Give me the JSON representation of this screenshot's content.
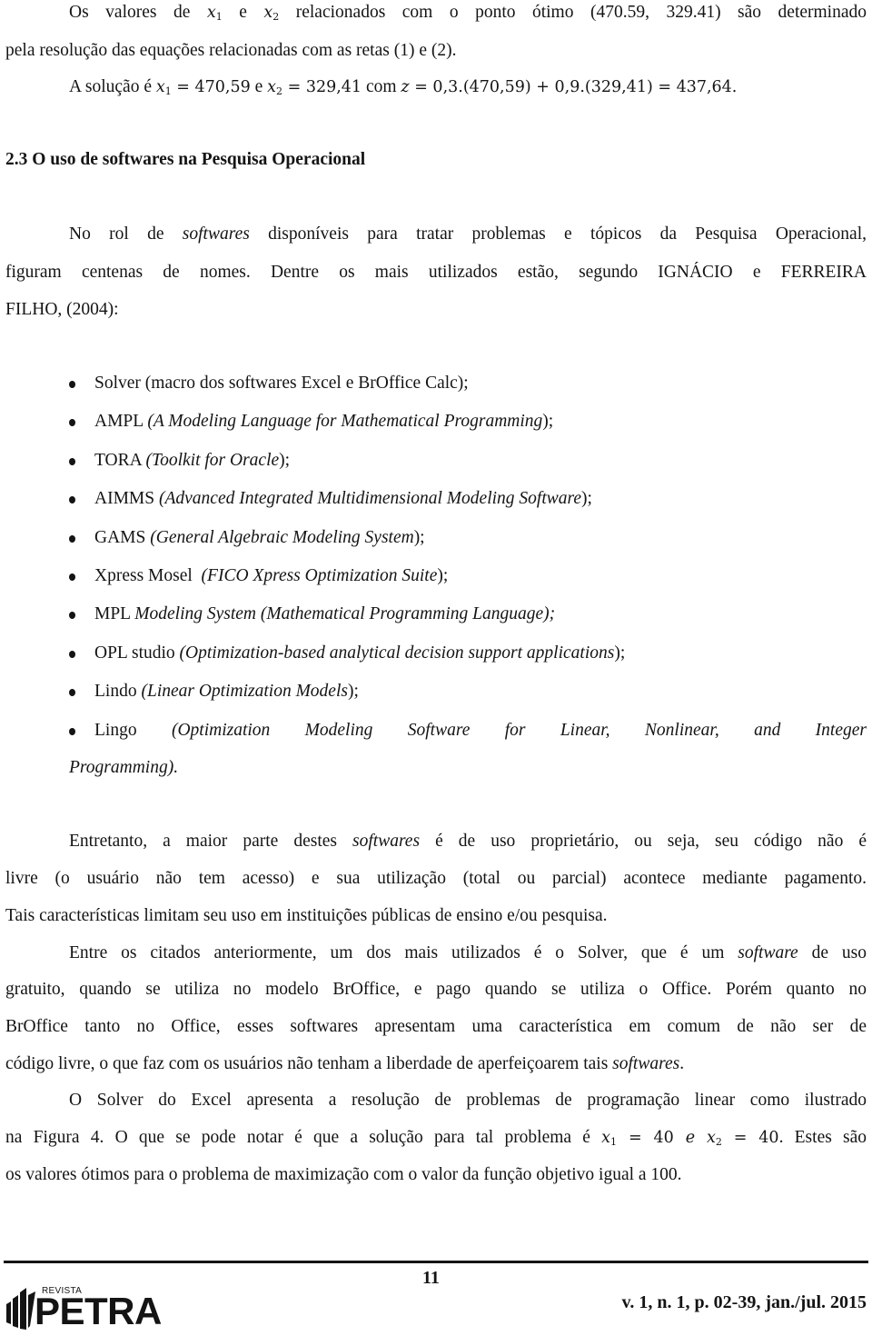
{
  "intro": {
    "p1_line1": {
      "a": "Os valores de ",
      "x1": "x",
      "x1_sub": "1",
      "b": " e ",
      "x2": "x",
      "x2_sub": "2",
      "c": " relacionados com o ponto ótimo (470.59, 329.41) são determinado"
    },
    "p1_line2": "pela resolução das equações relacionadas com as retas (1) e (2).",
    "p2": {
      "a": "A solução é ",
      "x1": "x",
      "x1_sub": "1",
      "x1_val": " = 470,59",
      "b": " e ",
      "x2": "x",
      "x2_sub": "2",
      "x2_val": " = 329,41",
      "c": " com ",
      "z": "z",
      "z_expr": " = 0,3.(470,59) + 0,9.(329,41) = 437,64."
    }
  },
  "section": {
    "heading": "2.3 O uso de softwares na Pesquisa Operacional",
    "intro_line1": {
      "a": "No rol de ",
      "italic": "softwares",
      "b": " disponíveis para tratar problemas e tópicos da Pesquisa Operacional,"
    },
    "intro_line2": "figuram centenas de nomes. Dentre os mais utilizados estão, segundo IGNÁCIO e FERREIRA",
    "intro_line3": "FILHO, (2004):"
  },
  "software_list": [
    {
      "name": "Solver",
      "desc": " (macro dos softwares Excel e BrOffice Calc);",
      "desc_italic": false
    },
    {
      "name": "AMPL ",
      "open": "(",
      "desc": "A Modeling Language for Mathematical Programming",
      "close": ");",
      "desc_italic": true
    },
    {
      "name": "TORA ",
      "open": "(",
      "desc": "Toolkit for Oracle",
      "close": ");",
      "desc_italic": true
    },
    {
      "name": "AIMMS ",
      "open": "(",
      "desc": "Advanced Integrated Multidimensional Modeling Software",
      "close": ");",
      "desc_italic": true
    },
    {
      "name": "GAMS ",
      "open": "(",
      "desc": "General Algebraic Modeling System",
      "close": ");",
      "desc_italic": true
    },
    {
      "name": "Xpress Mosel  ",
      "open": "(",
      "desc": "FICO Xpress Optimization Suite",
      "close": ");",
      "desc_italic": true
    },
    {
      "name": "MPL ",
      "open": "",
      "desc": "Modeling System (Mathematical Programming Language);",
      "close": "",
      "desc_italic": true
    },
    {
      "name": "OPL studio ",
      "open": "(",
      "desc": "Optimization-based analytical decision support applications",
      "close": ");",
      "desc_italic": true
    },
    {
      "name": "Lindo ",
      "open": "(",
      "desc": "Linear Optimization Models",
      "close": ");",
      "desc_italic": true
    },
    {
      "name": "Lingo ",
      "open": "",
      "desc": "(Optimization Modeling Software for Linear, Nonlinear, and Integer",
      "close": "",
      "desc_italic": true
    }
  ],
  "software_list_continuation": "Programming).",
  "paragraphs": {
    "p3_line1": {
      "a": "Entretanto, a maior parte destes ",
      "italic": "softwares",
      "b": " é de uso proprietário, ou seja, seu código não é"
    },
    "p3_line2": "livre (o usuário não tem acesso) e sua utilização (total ou parcial) acontece mediante pagamento.",
    "p3_line3": "Tais características limitam seu uso em instituições públicas de ensino e/ou pesquisa.",
    "p4_line1": {
      "a": "Entre os citados anteriormente, um dos mais utilizados é o Solver, que é um ",
      "italic": "software",
      "b": " de uso"
    },
    "p4_line2": "gratuito, quando se utiliza no modelo BrOffice, e pago quando se utiliza o Office. Porém quanto no",
    "p4_line3": "BrOffice tanto no Office, esses softwares apresentam uma característica em comum de não ser de",
    "p4_line4": {
      "a": "código livre, o que faz com os usuários não tenham a liberdade de aperfeiçoarem tais ",
      "italic": "softwares",
      "b": "."
    },
    "p5_line1": "O Solver do Excel apresenta a resolução de problemas de programação linear como ilustrado",
    "p5_line2": {
      "a": "na Figura 4. O que se pode notar é que a solução para tal problema é ",
      "x1": "x",
      "x1_sub": "1",
      "x1_val": " = 40 ",
      "e": "e",
      "x2": " x",
      "x2_sub": "2",
      "x2_val": " = 40",
      "b": ". Estes são"
    },
    "p5_line3": "os valores ótimos para o problema de maximização com o valor da função objetivo igual a 100."
  },
  "footer": {
    "page_number": "11",
    "logo_small": "REVISTA",
    "logo_big": "PETRA",
    "citation": "v. 1, n. 1, p. 02-39, jan./jul. 2015"
  }
}
